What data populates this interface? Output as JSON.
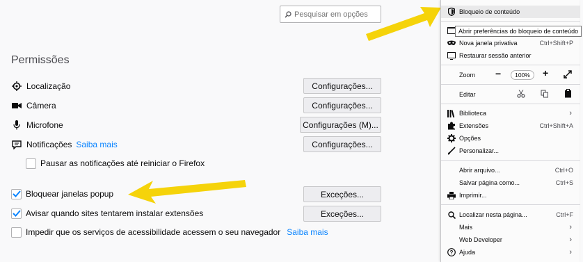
{
  "search": {
    "placeholder": "Pesquisar em opções"
  },
  "permissions": {
    "title": "Permissões",
    "items": [
      {
        "icon": "location-icon",
        "label": "Localização",
        "button": "Configurações..."
      },
      {
        "icon": "camera-icon",
        "label": "Câmera",
        "button": "Configurações..."
      },
      {
        "icon": "microphone-icon",
        "label": "Microfone",
        "button": "Configurações (M)..."
      },
      {
        "icon": "notification-icon",
        "label": "Notificações",
        "link": "Saiba mais",
        "button": "Configurações..."
      }
    ],
    "pause_notifications": "Pausar as notificações até reiniciar o Firefox",
    "block_popups": "Bloquear janelas popup",
    "warn_addons": "Avisar quando sites tentarem instalar extensões",
    "block_accessibility": "Impedir que os serviços de acessibilidade acessem o seu navegador",
    "accessibility_link": "Saiba mais",
    "exceptions_label": "Exceções..."
  },
  "menu": {
    "content_blocking": "Bloqueio de conteúdo",
    "tooltip": "Abrir preferências do bloqueio de conteúdo",
    "new_private_window": "Nova janela privativa",
    "new_private_window_shortcut": "Ctrl+Shift+P",
    "restore_session": "Restaurar sessão anterior",
    "zoom_label": "Zoom",
    "zoom_value": "100%",
    "edit_label": "Editar",
    "library": "Biblioteca",
    "extensions": "Extensões",
    "extensions_shortcut": "Ctrl+Shift+A",
    "options": "Opções",
    "customize": "Personalizar...",
    "open_file": "Abrir arquivo...",
    "open_file_shortcut": "Ctrl+O",
    "save_page": "Salvar página como...",
    "save_page_shortcut": "Ctrl+S",
    "print": "Imprimir...",
    "find": "Localizar nesta página...",
    "find_shortcut": "Ctrl+F",
    "more": "Mais",
    "web_developer": "Web Developer",
    "help": "Ajuda"
  },
  "colors": {
    "accent": "#0a84ff",
    "arrow": "#f5d30a",
    "check": "#0a84ff"
  }
}
